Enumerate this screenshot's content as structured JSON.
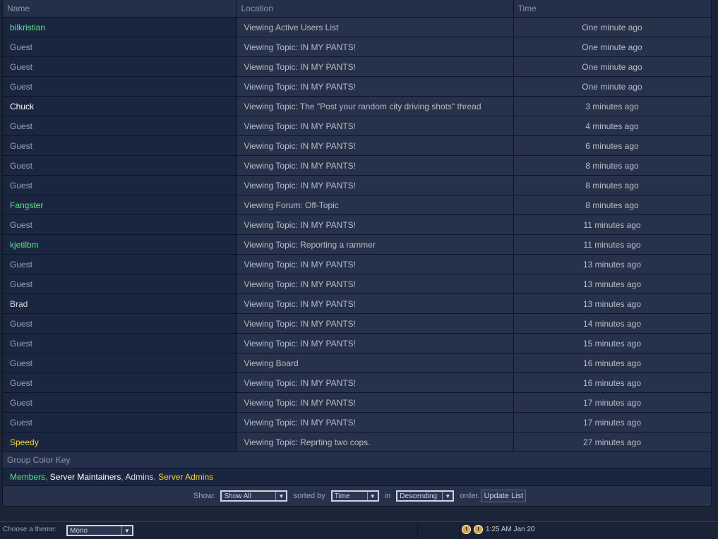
{
  "table": {
    "headers": [
      "Name",
      "Location",
      "Time"
    ],
    "rows": [
      {
        "name": "bilkristian",
        "group": "member",
        "location": "Viewing Active Users List",
        "time": "One minute ago"
      },
      {
        "name": "Guest",
        "group": "guest",
        "location": "Viewing Topic: IN MY PANTS!",
        "time": "One minute ago"
      },
      {
        "name": "Guest",
        "group": "guest",
        "location": "Viewing Topic: IN MY PANTS!",
        "time": "One minute ago"
      },
      {
        "name": "Guest",
        "group": "guest",
        "location": "Viewing Topic: IN MY PANTS!",
        "time": "One minute ago"
      },
      {
        "name": "Chuck",
        "group": "maint",
        "location": "Viewing Topic: The \"Post your random city driving shots\" thread",
        "time": "3 minutes ago"
      },
      {
        "name": "Guest",
        "group": "guest",
        "location": "Viewing Topic: IN MY PANTS!",
        "time": "4 minutes ago"
      },
      {
        "name": "Guest",
        "group": "guest",
        "location": "Viewing Topic: IN MY PANTS!",
        "time": "6 minutes ago"
      },
      {
        "name": "Guest",
        "group": "guest",
        "location": "Viewing Topic: IN MY PANTS!",
        "time": "8 minutes ago"
      },
      {
        "name": "Guest",
        "group": "guest",
        "location": "Viewing Topic: IN MY PANTS!",
        "time": "8 minutes ago"
      },
      {
        "name": "Fangster",
        "group": "member",
        "location": "Viewing Forum: Off-Topic",
        "time": "8 minutes ago"
      },
      {
        "name": "Guest",
        "group": "guest",
        "location": "Viewing Topic: IN MY PANTS!",
        "time": "11 minutes ago"
      },
      {
        "name": "kjetilbm",
        "group": "member",
        "location": "Viewing Topic: Reporting a rammer",
        "time": "11 minutes ago"
      },
      {
        "name": "Guest",
        "group": "guest",
        "location": "Viewing Topic: IN MY PANTS!",
        "time": "13 minutes ago"
      },
      {
        "name": "Guest",
        "group": "guest",
        "location": "Viewing Topic: IN MY PANTS!",
        "time": "13 minutes ago"
      },
      {
        "name": "Brad",
        "group": "admin",
        "location": "Viewing Topic: IN MY PANTS!",
        "time": "13 minutes ago"
      },
      {
        "name": "Guest",
        "group": "guest",
        "location": "Viewing Topic: IN MY PANTS!",
        "time": "14 minutes ago"
      },
      {
        "name": "Guest",
        "group": "guest",
        "location": "Viewing Topic: IN MY PANTS!",
        "time": "15 minutes ago"
      },
      {
        "name": "Guest",
        "group": "guest",
        "location": "Viewing Board",
        "time": "16 minutes ago"
      },
      {
        "name": "Guest",
        "group": "guest",
        "location": "Viewing Topic: IN MY PANTS!",
        "time": "16 minutes ago"
      },
      {
        "name": "Guest",
        "group": "guest",
        "location": "Viewing Topic: IN MY PANTS!",
        "time": "17 minutes ago"
      },
      {
        "name": "Guest",
        "group": "guest",
        "location": "Viewing Topic: IN MY PANTS!",
        "time": "17 minutes ago"
      },
      {
        "name": "Speedy",
        "group": "sadmin",
        "location": "Viewing Topic: Reprting two cops.",
        "time": "27 minutes ago"
      }
    ]
  },
  "color_key": {
    "title": "Group Color Key",
    "groups": [
      {
        "label": "Members",
        "color": "#5de08a"
      },
      {
        "label": "Server Maintainers",
        "color": "#ffffff"
      },
      {
        "label": "Admins",
        "color": "#d7dbe2"
      },
      {
        "label": "Server Admins",
        "color": "#f0d23a"
      }
    ],
    "separator": ", "
  },
  "controls": {
    "show_label": "Show:",
    "show_value": "Show All",
    "sorted_label": "sorted by",
    "sort_value": "Time",
    "in_label": "in",
    "order_value": "Descending",
    "order_label": "order.",
    "update_button": "Update List"
  },
  "footer": {
    "theme_label": "Choose a theme:",
    "theme_value": "Mono",
    "clock_text": "1:25 AM Jan 20",
    "icons": [
      "compass-icon",
      "compass-icon"
    ]
  }
}
